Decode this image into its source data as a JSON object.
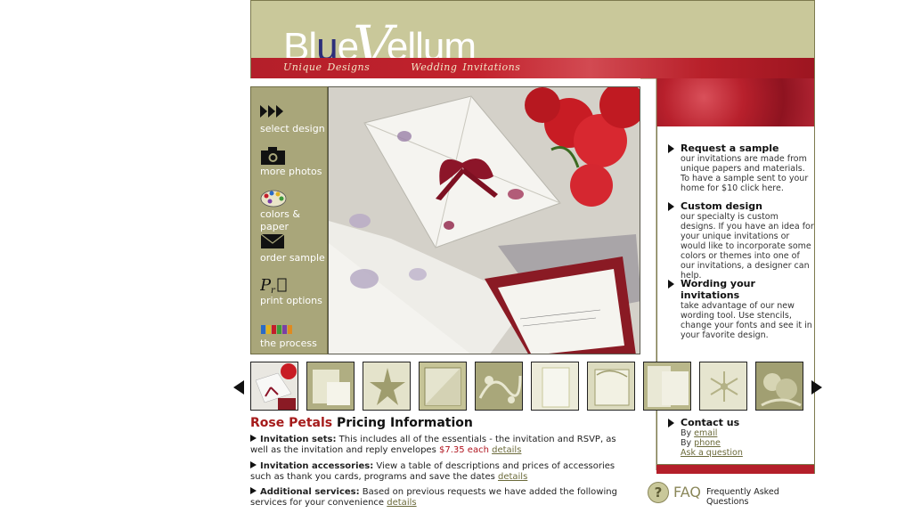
{
  "header": {
    "logo_blue_letters": "Bl",
    "logo_u": "u",
    "logo_e": "e",
    "logo_v": "V",
    "logo_rest": "ellum",
    "tagline_1": "Unique Designs",
    "tagline_2": "Wedding Invitations"
  },
  "nav": {
    "items": [
      {
        "label": "select design",
        "icon": "triple-arrow-icon"
      },
      {
        "label": "more photos",
        "icon": "camera-icon"
      },
      {
        "label": "colors & paper",
        "icon": "palette-icon"
      },
      {
        "label": "order sample",
        "icon": "envelope-icon"
      },
      {
        "label": "print options",
        "icon": "print-options-icon"
      },
      {
        "label": "the process",
        "icon": "process-icon"
      }
    ]
  },
  "info": {
    "request": {
      "title": "Request a sample",
      "text": "our invitations are made from unique papers and materials. To have a sample sent to your home for $10 click here."
    },
    "custom": {
      "title": "Custom design",
      "text": "our specialty is custom designs. If you have an idea for your unique invitations or would like to incorporate some colors or themes into one of our invitations, a designer can help."
    },
    "wording": {
      "title": "Wording your invitations",
      "text": "take advantage of our new wording tool. Use stencils, change your fonts and see it in your favorite design."
    },
    "contact": {
      "title": "Contact us",
      "by1": "By ",
      "email": "email",
      "by2": "By ",
      "phone": "phone",
      "ask": "Ask a question"
    }
  },
  "pricing": {
    "title_accent": "Rose Petals",
    "title_rest": " Pricing Information",
    "sets_label": "Invitation sets:",
    "sets_text": " This includes all of the essentials - the invitation and RSVP, as well as the invitation and reply envelopes ",
    "sets_price": "$7.35 each",
    "sets_link": "details",
    "acc_label": "Invitation accessories:",
    "acc_text": " View a table of descriptions and prices of accessories such as thank you cards, programs and save the dates ",
    "acc_link": "details",
    "add_label": "Additional services:",
    "add_text": " Based on previous requests we have added the following services for your convenience ",
    "add_link": "details"
  },
  "faq": {
    "icon_glyph": "?",
    "big": "FAQ",
    "small": "Frequently Asked Questions"
  },
  "colors": {
    "olive": "#c9c89a",
    "nav_olive": "#a9a67a",
    "red": "#b41f2a",
    "price_red": "#b0151f"
  }
}
